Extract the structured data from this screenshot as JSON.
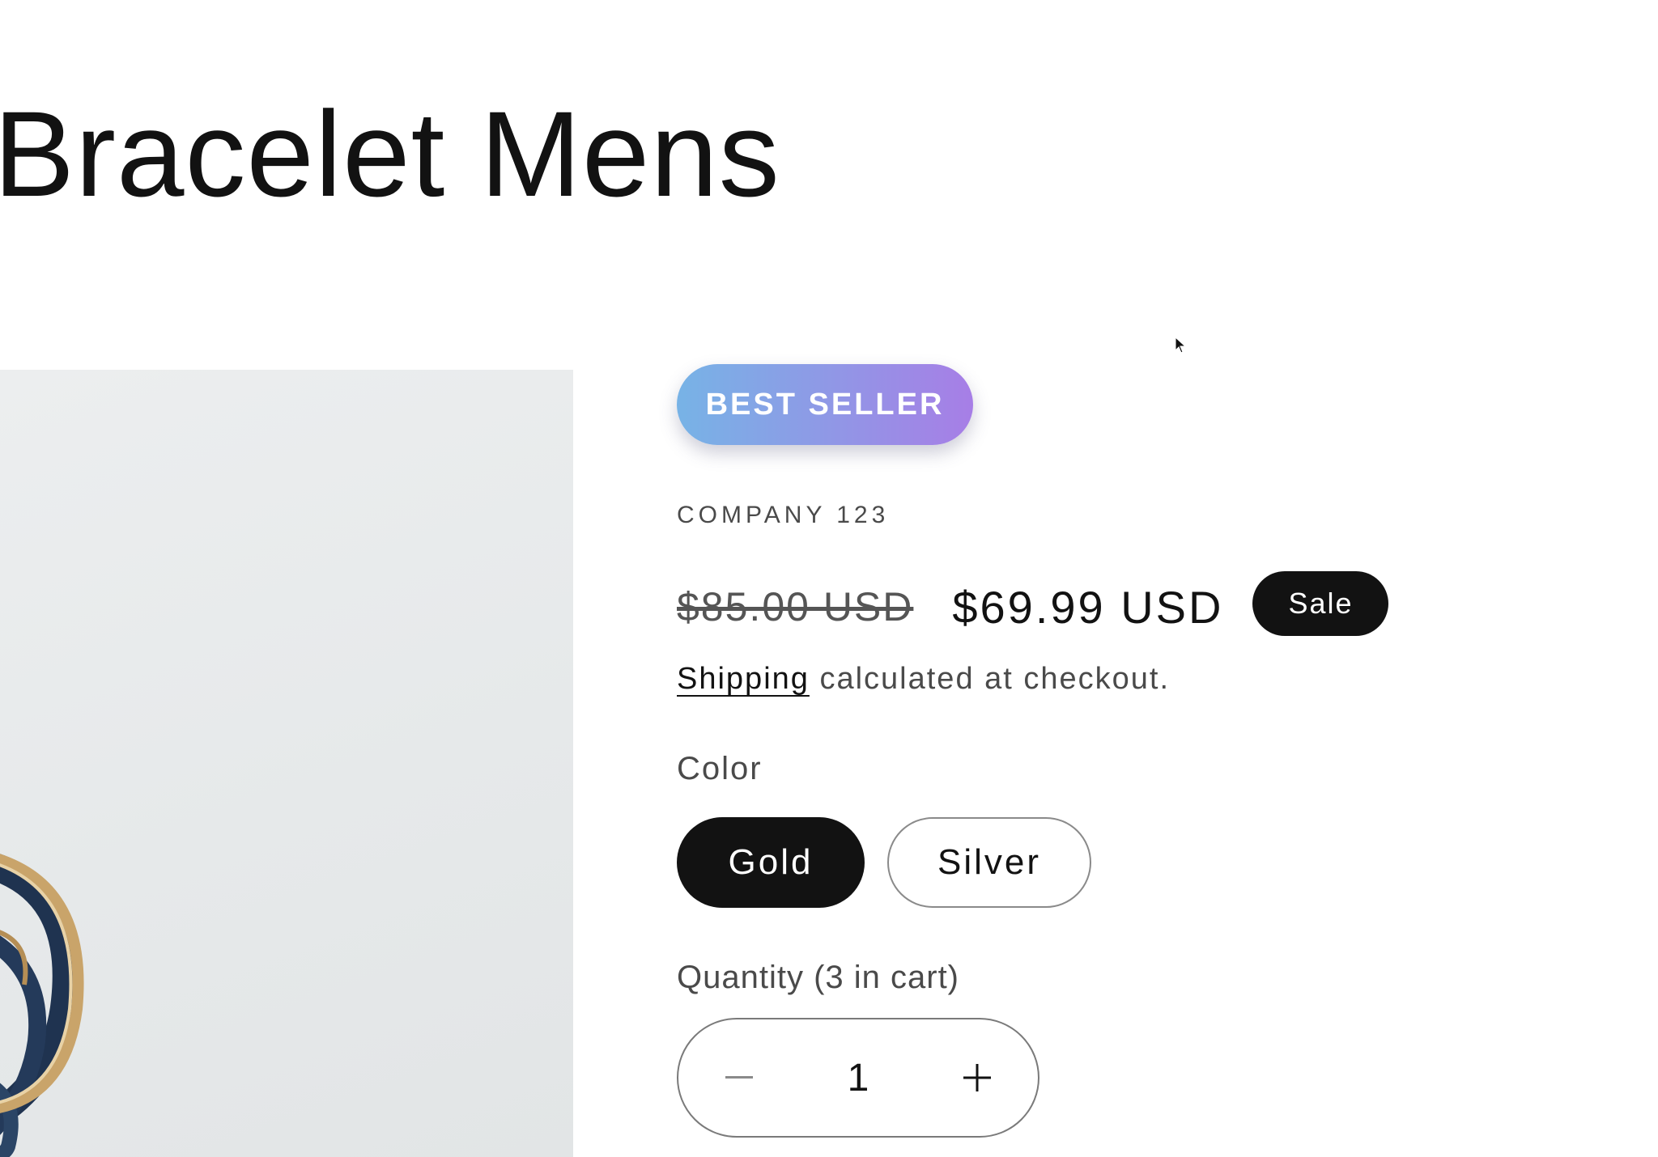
{
  "product": {
    "title": "Bracelet Mens",
    "badge": "BEST SELLER",
    "vendor": "COMPANY 123",
    "price_regular": "$85.00 USD",
    "price_sale": "$69.99 USD",
    "sale_badge": "Sale",
    "shipping_link": "Shipping",
    "shipping_rest": " calculated at checkout."
  },
  "color": {
    "label": "Color",
    "options": [
      "Gold",
      "Silver"
    ],
    "selected": "Gold"
  },
  "quantity": {
    "label": "Quantity (3 in cart)",
    "value": "1"
  },
  "icons": {
    "decrease": "minus-icon",
    "increase": "plus-icon",
    "cursor": "mouse-pointer-icon"
  },
  "colors": {
    "badge_gradient_start": "#77b3e6",
    "badge_gradient_end": "#a77ee6",
    "selected_swatch": "#121212"
  }
}
